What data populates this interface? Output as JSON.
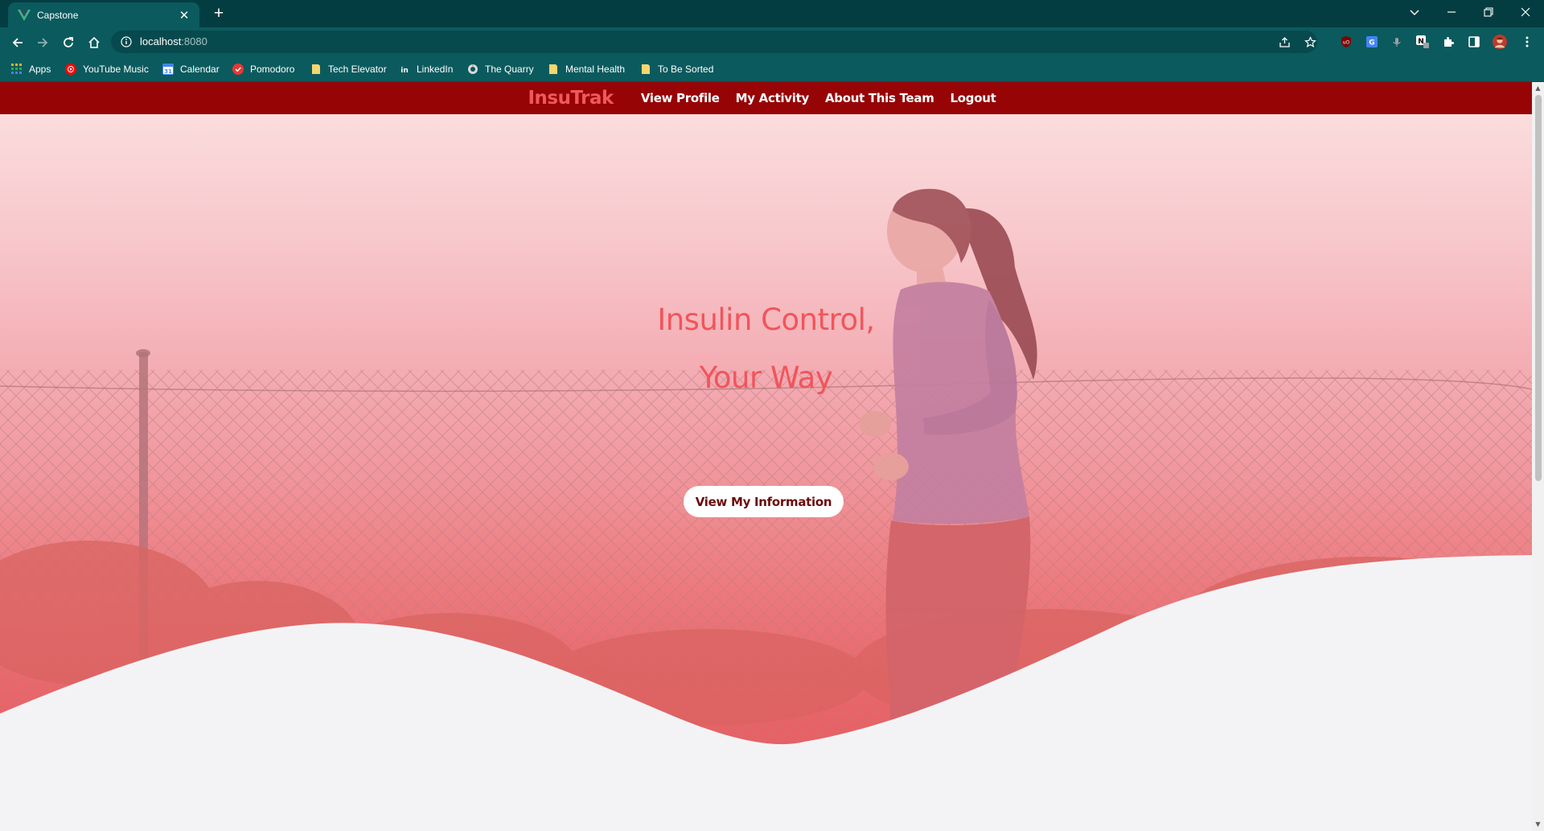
{
  "browser": {
    "tab_title": "Capstone",
    "url_host": "localhost",
    "url_port": ":8080",
    "icons": {
      "tab": "vue-logo-icon",
      "close": "close-icon",
      "new_tab": "plus-icon",
      "back": "back-arrow-icon",
      "forward": "forward-arrow-icon",
      "reload": "reload-icon",
      "home": "home-icon",
      "site_info": "info-icon",
      "share": "share-icon",
      "bookmark": "star-icon",
      "extensions": "puzzle-icon",
      "side_panel": "side-panel-icon",
      "profile": "avatar",
      "menu": "kebab-menu-icon"
    },
    "bookmarks": [
      {
        "label": "Apps",
        "icon": "apps-grid-icon",
        "color": "#f4b400"
      },
      {
        "label": "YouTube Music",
        "icon": "youtube-music-icon",
        "color": "#ff0000"
      },
      {
        "label": "Calendar",
        "icon": "calendar-icon",
        "color": "#4285f4"
      },
      {
        "label": "Pomodoro",
        "icon": "pomodoro-icon",
        "color": "#e53935"
      },
      {
        "label": "Tech Elevator",
        "icon": "folder-icon",
        "color": "#f6d66f"
      },
      {
        "label": "LinkedIn",
        "icon": "linkedin-icon",
        "color": "#0a66c2"
      },
      {
        "label": "The Quarry",
        "icon": "quarry-icon",
        "color": "#d9d9d9"
      },
      {
        "label": "Mental Health",
        "icon": "folder-icon",
        "color": "#f6d66f"
      },
      {
        "label": "To Be Sorted",
        "icon": "folder-icon",
        "color": "#f6d66f"
      }
    ]
  },
  "nav": {
    "brand": "InsuTrak",
    "links": [
      "View Profile",
      "My Activity",
      "About This Team",
      "Logout"
    ]
  },
  "hero": {
    "title_line1": "Insulin Control,",
    "title_line2": "Your Way",
    "cta_label": "View My Information"
  },
  "colors": {
    "nav_bg": "#960406",
    "brand": "#f0585e",
    "hero_title": "#f0555b",
    "cta_text": "#6b0a0c"
  }
}
